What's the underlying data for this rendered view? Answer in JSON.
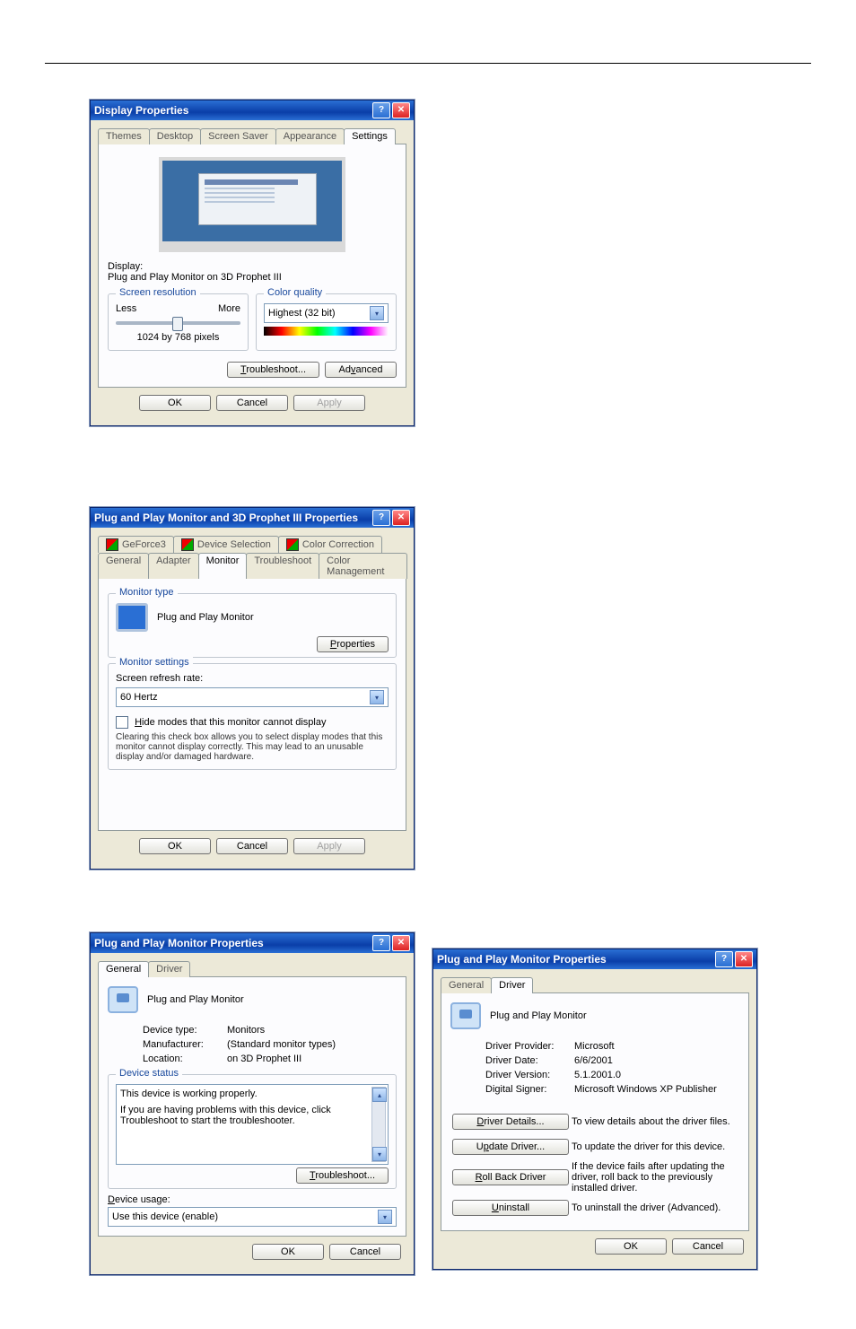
{
  "window1": {
    "title": "Display Properties",
    "tabs": [
      "Themes",
      "Desktop",
      "Screen Saver",
      "Appearance",
      "Settings"
    ],
    "active_tab": "Settings",
    "display_label": "Display:",
    "display_value": "Plug and Play Monitor on 3D Prophet III",
    "screen_res_legend": "Screen resolution",
    "less": "Less",
    "more": "More",
    "res_value": "1024 by 768 pixels",
    "color_legend": "Color quality",
    "color_value": "Highest (32 bit)",
    "troubleshoot": "Troubleshoot...",
    "advanced": "Advanced",
    "ok": "OK",
    "cancel": "Cancel",
    "apply": "Apply"
  },
  "window2": {
    "title": "Plug and Play Monitor and 3D Prophet III Properties",
    "tabs_row1": [
      "GeForce3",
      "Device Selection",
      "Color Correction"
    ],
    "tabs_row2": [
      "General",
      "Adapter",
      "Monitor",
      "Troubleshoot",
      "Color Management"
    ],
    "active_tab": "Monitor",
    "monitor_type_legend": "Monitor type",
    "monitor_name": "Plug and Play Monitor",
    "properties_btn": "Properties",
    "monitor_settings_legend": "Monitor settings",
    "refresh_label": "Screen refresh rate:",
    "refresh_value": "60 Hertz",
    "hide_modes": "Hide modes that this monitor cannot display",
    "hide_modes_desc": "Clearing this check box allows you to select display modes that this monitor cannot display correctly. This may lead to an unusable display and/or damaged hardware.",
    "ok": "OK",
    "cancel": "Cancel",
    "apply": "Apply"
  },
  "window3": {
    "title": "Plug and Play Monitor Properties",
    "tabs": [
      "General",
      "Driver"
    ],
    "active_tab": "General",
    "device_name": "Plug and Play Monitor",
    "device_type_label": "Device type:",
    "device_type_value": "Monitors",
    "manufacturer_label": "Manufacturer:",
    "manufacturer_value": "(Standard monitor types)",
    "location_label": "Location:",
    "location_value": "on 3D Prophet III",
    "status_legend": "Device status",
    "status_line1": "This device is working properly.",
    "status_line2": "If you are having problems with this device, click Troubleshoot to start the troubleshooter.",
    "troubleshoot": "Troubleshoot...",
    "usage_label": "Device usage:",
    "usage_value": "Use this device (enable)",
    "ok": "OK",
    "cancel": "Cancel"
  },
  "window4": {
    "title": "Plug and Play Monitor Properties",
    "tabs": [
      "General",
      "Driver"
    ],
    "active_tab": "Driver",
    "device_name": "Plug and Play Monitor",
    "provider_label": "Driver Provider:",
    "provider_value": "Microsoft",
    "date_label": "Driver Date:",
    "date_value": "6/6/2001",
    "version_label": "Driver Version:",
    "version_value": "5.1.2001.0",
    "signer_label": "Digital Signer:",
    "signer_value": "Microsoft Windows XP Publisher",
    "details_btn": "Driver Details...",
    "details_desc": "To view details about the driver files.",
    "update_btn": "Update Driver...",
    "update_desc": "To update the driver for this device.",
    "rollback_btn": "Roll Back Driver",
    "rollback_desc": "If the device fails after updating the driver, roll back to the previously installed driver.",
    "uninstall_btn": "Uninstall",
    "uninstall_desc": "To uninstall the driver (Advanced).",
    "ok": "OK",
    "cancel": "Cancel"
  }
}
